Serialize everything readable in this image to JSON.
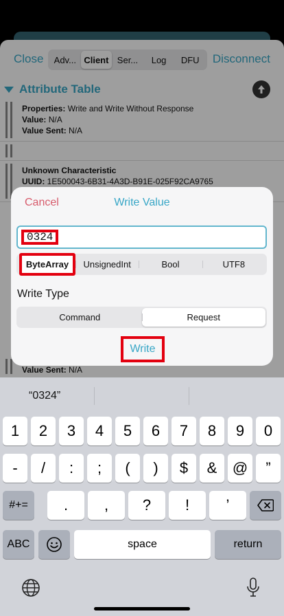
{
  "topbar": {
    "close": "Close",
    "disconnect": "Disconnect",
    "tabs": [
      "Adv...",
      "Client",
      "Ser...",
      "Log",
      "DFU"
    ],
    "active_tab": "Client"
  },
  "attributes": {
    "title": "Attribute Table",
    "row1": {
      "props_label": "Properties:",
      "props": "Write and Write Without Response",
      "value_label": "Value:",
      "value": "N/A",
      "sent_label": "Value Sent:",
      "sent": "N/A"
    },
    "row2": {
      "name": "Unknown Characteristic",
      "uuid_label": "UUID:",
      "uuid": "1E500043-6B31-4A3D-B91E-025F92CA9765"
    },
    "row3": {
      "sent_label": "Value Sent:",
      "sent": "N/A"
    }
  },
  "dialog": {
    "cancel": "Cancel",
    "title": "Write Value",
    "value": "0324",
    "formats": [
      "ByteArray",
      "UnsignedInt",
      "Bool",
      "UTF8"
    ],
    "selected_format": "ByteArray",
    "write_type_label": "Write Type",
    "write_types": [
      "Command",
      "Request"
    ],
    "selected_write_type": "Request",
    "write": "Write"
  },
  "keyboard": {
    "suggestion": "“0324”",
    "row1": [
      "1",
      "2",
      "3",
      "4",
      "5",
      "6",
      "7",
      "8",
      "9",
      "0"
    ],
    "row2": [
      "-",
      "/",
      ":",
      ";",
      "(",
      ")",
      "$",
      "&",
      "@",
      "”"
    ],
    "row3": {
      "toggle": "#+=",
      "keys": [
        ".",
        ",",
        "?",
        "!",
        "’"
      ],
      "delete": "⌫"
    },
    "row4": {
      "abc": "ABC",
      "emoji": "☺",
      "space": "space",
      "return": "return"
    },
    "globe": "globe-icon",
    "mic": "mic-icon"
  },
  "colors": {
    "accent": "#37a6c6",
    "cancel": "#d75b6b",
    "highlight": "#e3000f"
  }
}
